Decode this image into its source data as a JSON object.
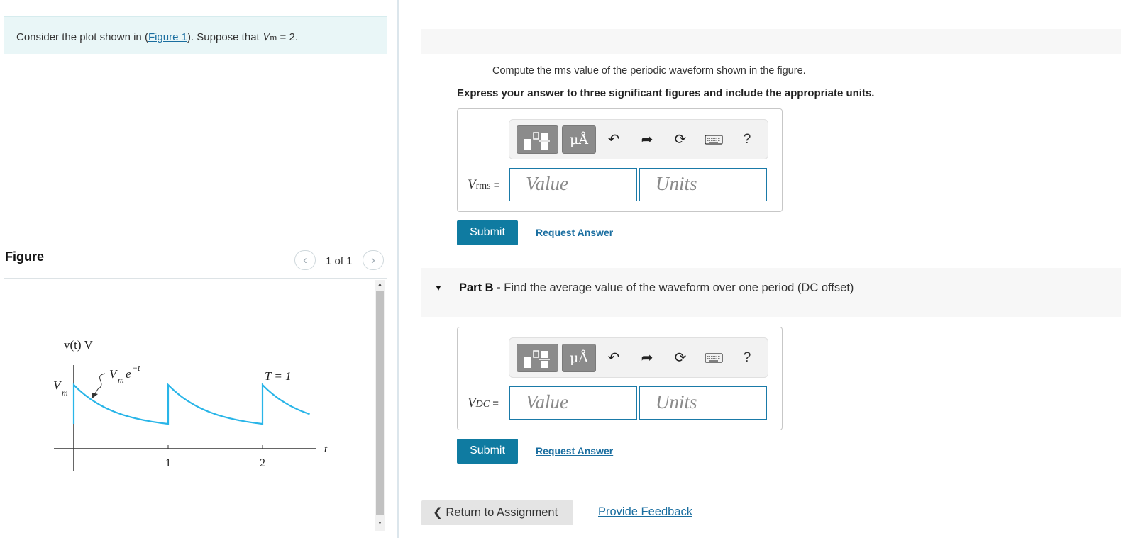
{
  "problem": {
    "prefix": "Consider the plot shown in (",
    "figure_link": "Figure 1",
    "middle": "). Suppose that ",
    "var": "V",
    "var_sub": "m",
    "suffix": " = 2."
  },
  "figure_panel": {
    "title": "Figure",
    "prev_icon": "chevron-left-icon",
    "next_icon": "chevron-right-icon",
    "count": "1 of 1"
  },
  "figure": {
    "y_label": "v(t) V",
    "vm_label": "V",
    "vm_sub": "m",
    "curve_label": "V",
    "curve_label_sub": "m",
    "curve_label_exp": "e",
    "curve_label_pow": "−t",
    "period_label": "T = 1",
    "x_label": "t",
    "ticks": [
      "1",
      "2"
    ],
    "curve_color": "#29b5e8"
  },
  "part_a": {
    "instruction": "Compute the rms value of the periodic waveform shown in the figure.",
    "instruction_bold": "Express your answer to three significant figures and include the appropriate units.",
    "toolbar": {
      "units_label": "μÅ",
      "undo_icon": "undo-icon",
      "redo_icon": "redo-icon",
      "reset_icon": "reset-icon",
      "keyboard_icon": "keyboard-icon",
      "help": "?"
    },
    "lhs_var": "V",
    "lhs_sub": "rms",
    "lhs_eq": " =",
    "value_placeholder": "Value",
    "units_placeholder": "Units",
    "submit": "Submit",
    "request": "Request Answer"
  },
  "part_b": {
    "label": "Part B -",
    "title": " Find the average value of the waveform over one period (DC offset)",
    "toolbar": {
      "units_label": "μÅ",
      "help": "?"
    },
    "lhs_var": "V",
    "lhs_sub": "DC",
    "lhs_eq": " =",
    "value_placeholder": "Value",
    "units_placeholder": "Units",
    "submit": "Submit",
    "request": "Request Answer"
  },
  "footer": {
    "return": "Return to Assignment",
    "feedback": "Provide Feedback"
  },
  "colors": {
    "accent": "#0f7ba1",
    "link": "#1a6ea0",
    "problem_bg": "#e9f6f7"
  }
}
